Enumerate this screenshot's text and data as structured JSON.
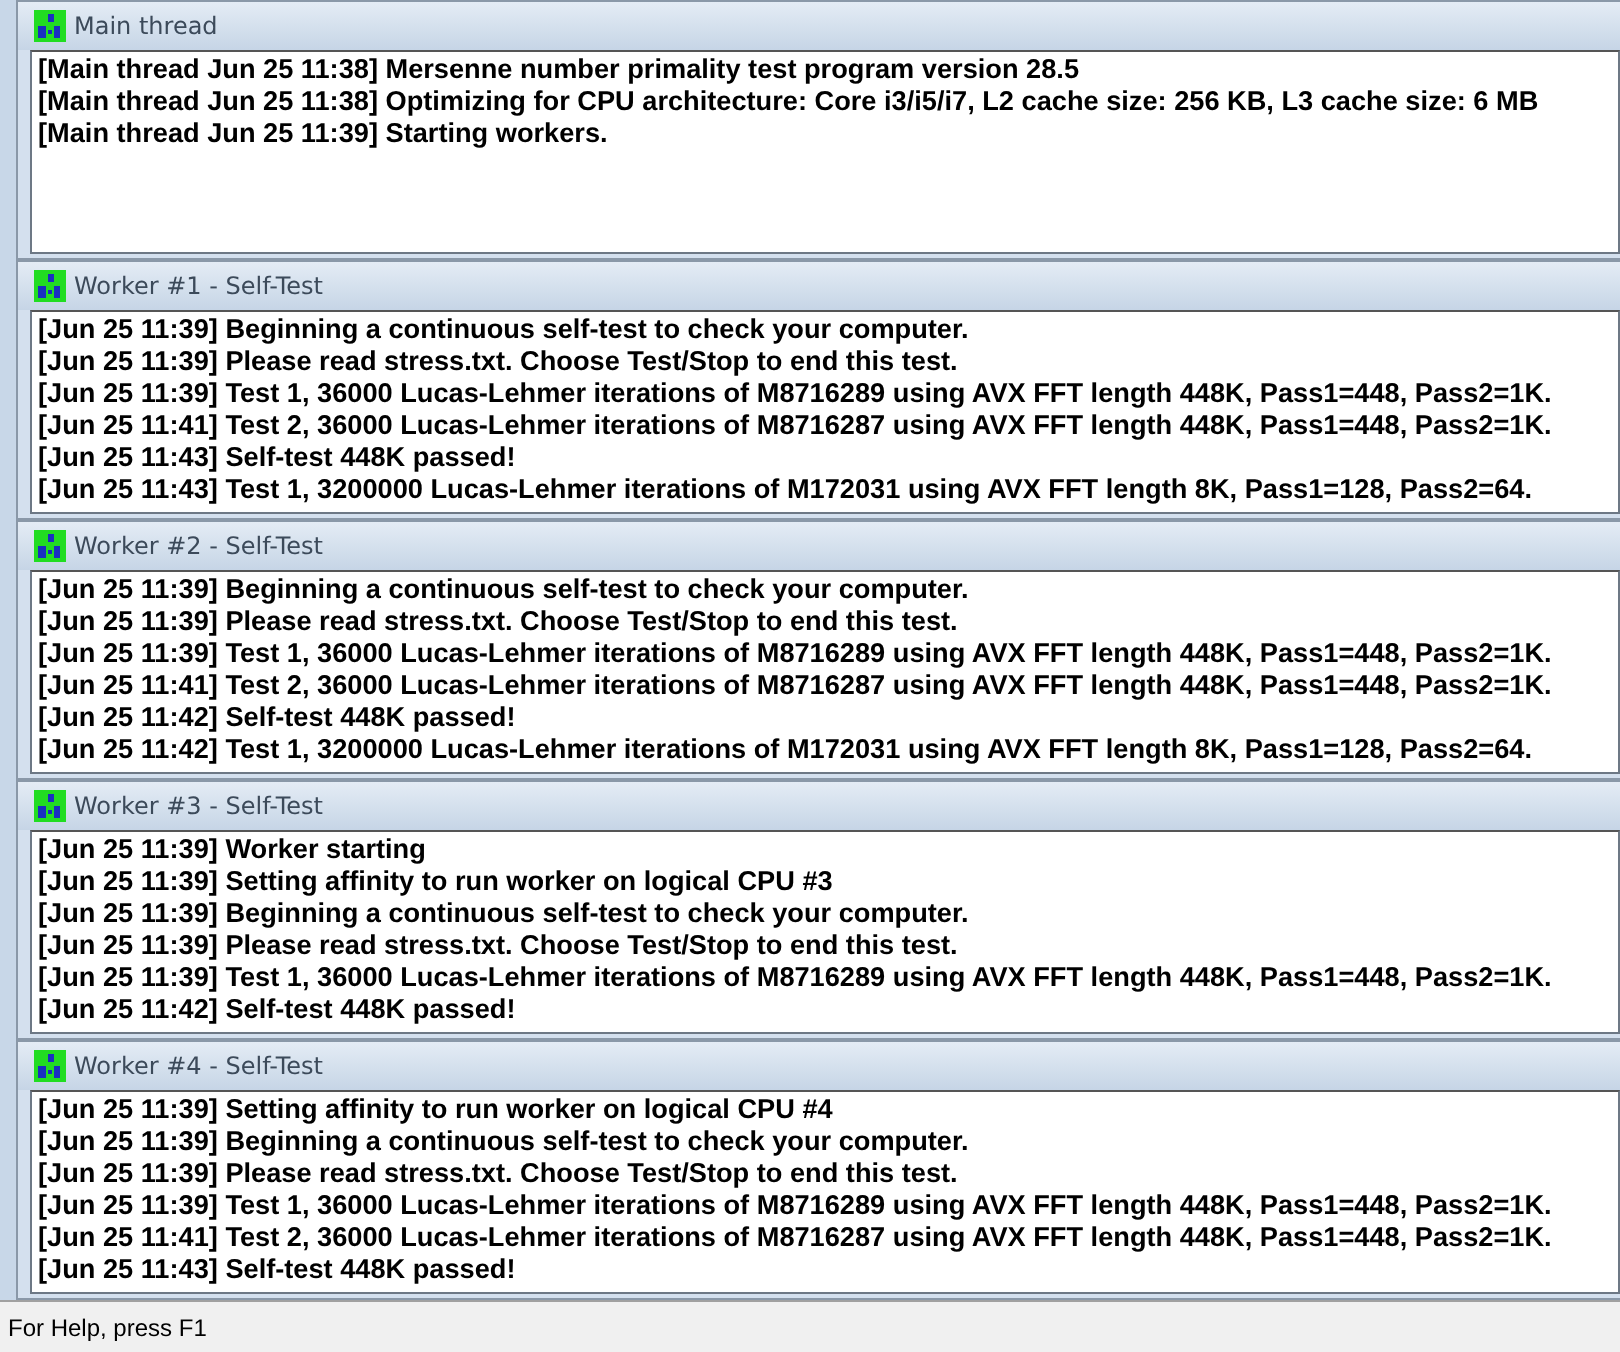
{
  "panes": [
    {
      "title": "Main thread",
      "lines": [
        "[Main thread Jun 25 11:38] Mersenne number primality test program version 28.5",
        "[Main thread Jun 25 11:38] Optimizing for CPU architecture: Core i3/i5/i7, L2 cache size: 256 KB, L3 cache size: 6 MB",
        "[Main thread Jun 25 11:39] Starting workers."
      ]
    },
    {
      "title": "Worker #1 - Self-Test",
      "lines": [
        "[Jun 25 11:39] Beginning a continuous self-test to check your computer.",
        "[Jun 25 11:39] Please read stress.txt.  Choose Test/Stop to end this test.",
        "[Jun 25 11:39] Test 1, 36000 Lucas-Lehmer iterations of M8716289 using AVX FFT length 448K, Pass1=448, Pass2=1K.",
        "[Jun 25 11:41] Test 2, 36000 Lucas-Lehmer iterations of M8716287 using AVX FFT length 448K, Pass1=448, Pass2=1K.",
        "[Jun 25 11:43] Self-test 448K passed!",
        "[Jun 25 11:43] Test 1, 3200000 Lucas-Lehmer iterations of M172031 using AVX FFT length 8K, Pass1=128, Pass2=64."
      ]
    },
    {
      "title": "Worker #2 - Self-Test",
      "lines": [
        "[Jun 25 11:39] Beginning a continuous self-test to check your computer.",
        "[Jun 25 11:39] Please read stress.txt.  Choose Test/Stop to end this test.",
        "[Jun 25 11:39] Test 1, 36000 Lucas-Lehmer iterations of M8716289 using AVX FFT length 448K, Pass1=448, Pass2=1K.",
        "[Jun 25 11:41] Test 2, 36000 Lucas-Lehmer iterations of M8716287 using AVX FFT length 448K, Pass1=448, Pass2=1K.",
        "[Jun 25 11:42] Self-test 448K passed!",
        "[Jun 25 11:42] Test 1, 3200000 Lucas-Lehmer iterations of M172031 using AVX FFT length 8K, Pass1=128, Pass2=64."
      ]
    },
    {
      "title": "Worker #3 - Self-Test",
      "lines": [
        "[Jun 25 11:39] Worker starting",
        "[Jun 25 11:39] Setting affinity to run worker on logical CPU #3",
        "[Jun 25 11:39] Beginning a continuous self-test to check your computer.",
        "[Jun 25 11:39] Please read stress.txt.  Choose Test/Stop to end this test.",
        "[Jun 25 11:39] Test 1, 36000 Lucas-Lehmer iterations of M8716289 using AVX FFT length 448K, Pass1=448, Pass2=1K.",
        "[Jun 25 11:42] Self-test 448K passed!"
      ]
    },
    {
      "title": "Worker #4 - Self-Test",
      "lines": [
        "[Jun 25 11:39] Setting affinity to run worker on logical CPU #4",
        "[Jun 25 11:39] Beginning a continuous self-test to check your computer.",
        "[Jun 25 11:39] Please read stress.txt.  Choose Test/Stop to end this test.",
        "[Jun 25 11:39] Test 1, 36000 Lucas-Lehmer iterations of M8716289 using AVX FFT length 448K, Pass1=448, Pass2=1K.",
        "[Jun 25 11:41] Test 2, 36000 Lucas-Lehmer iterations of M8716287 using AVX FFT length 448K, Pass1=448, Pass2=1K.",
        "[Jun 25 11:43] Self-test 448K passed!"
      ]
    }
  ],
  "status_bar": "For Help, press F1"
}
